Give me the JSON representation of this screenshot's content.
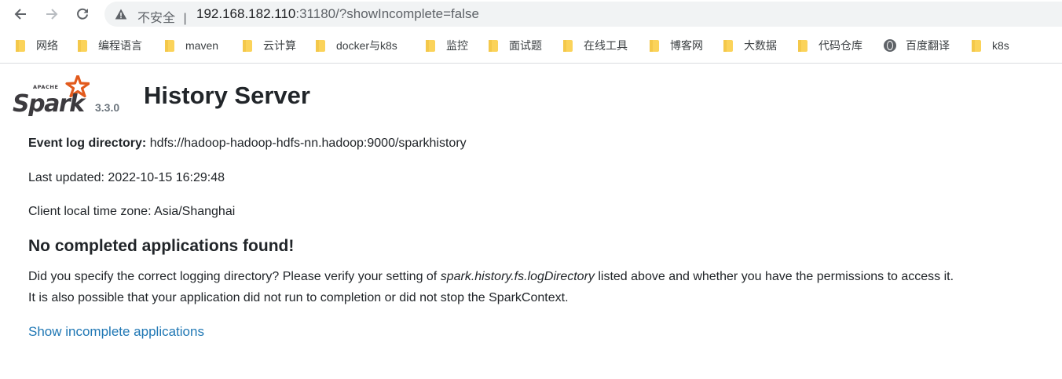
{
  "browser": {
    "security_label": "不安全",
    "separator": "|",
    "url_host": "192.168.182.110",
    "url_rest": ":31180/?showIncomplete=false",
    "bookmarks": [
      {
        "label": "网络",
        "icon": "folder-icon"
      },
      {
        "label": "编程语言",
        "icon": "folder-icon"
      },
      {
        "label": "maven",
        "icon": "folder-icon"
      },
      {
        "label": "云计算",
        "icon": "folder-icon"
      },
      {
        "label": "docker与k8s",
        "icon": "folder-icon"
      },
      {
        "label": "监控",
        "icon": "folder-icon"
      },
      {
        "label": "面试题",
        "icon": "folder-icon"
      },
      {
        "label": "在线工具",
        "icon": "folder-icon"
      },
      {
        "label": "博客网",
        "icon": "folder-icon"
      },
      {
        "label": "大数据",
        "icon": "folder-icon"
      },
      {
        "label": "代码仓库",
        "icon": "folder-icon"
      },
      {
        "label": "百度翻译",
        "icon": "globe-icon"
      },
      {
        "label": "k8s",
        "icon": "folder-icon"
      }
    ]
  },
  "page": {
    "logo_text": "Spark",
    "logo_small_text": "APACHE",
    "version": "3.3.0",
    "title": "History Server",
    "event_log_label": "Event log directory:",
    "event_log_value": "hdfs://hadoop-hadoop-hdfs-nn.hadoop:9000/sparkhistory",
    "last_updated": "Last updated: 2022-10-15 16:29:48",
    "timezone": "Client local time zone: Asia/Shanghai",
    "no_apps_heading": "No completed applications found!",
    "para1_before": "Did you specify the correct logging directory? Please verify your setting of ",
    "para1_code": "spark.history.fs.logDirectory",
    "para1_after": " listed above and whether you have the permissions to access it.",
    "para2": "It is also possible that your application did not run to completion or did not stop the SparkContext.",
    "show_incomplete": "Show incomplete applications"
  },
  "colors": {
    "link": "#1f77b4",
    "spark_orange": "#e25a1c",
    "spark_text": "#3c3a3e"
  }
}
